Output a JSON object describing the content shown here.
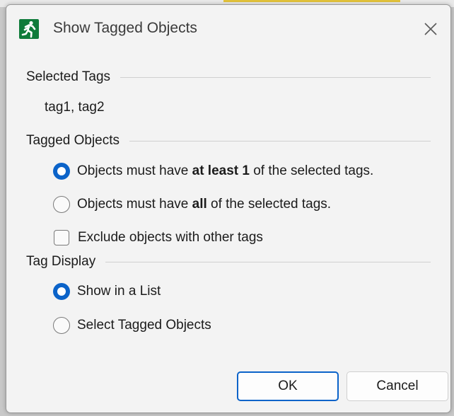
{
  "dialog": {
    "title": "Show Tagged Objects",
    "icon": "running-figure-icon",
    "accent_color": "#0b63c9",
    "icon_color": "#0f7b3a"
  },
  "selected_tags": {
    "heading": "Selected Tags",
    "value": "tag1, tag2"
  },
  "tagged_objects": {
    "heading": "Tagged Objects",
    "options": [
      {
        "prefix": "Objects must have ",
        "bold": "at least 1",
        "suffix": " of the selected tags.",
        "checked": true
      },
      {
        "prefix": "Objects must have ",
        "bold": "all",
        "suffix": " of the selected tags.",
        "checked": false
      }
    ],
    "exclude_label": "Exclude objects with other tags",
    "exclude_checked": false
  },
  "tag_display": {
    "heading": "Tag Display",
    "options": [
      {
        "label": "Show in a List",
        "checked": true
      },
      {
        "label": "Select Tagged Objects",
        "checked": false
      }
    ]
  },
  "buttons": {
    "ok": "OK",
    "cancel": "Cancel"
  }
}
